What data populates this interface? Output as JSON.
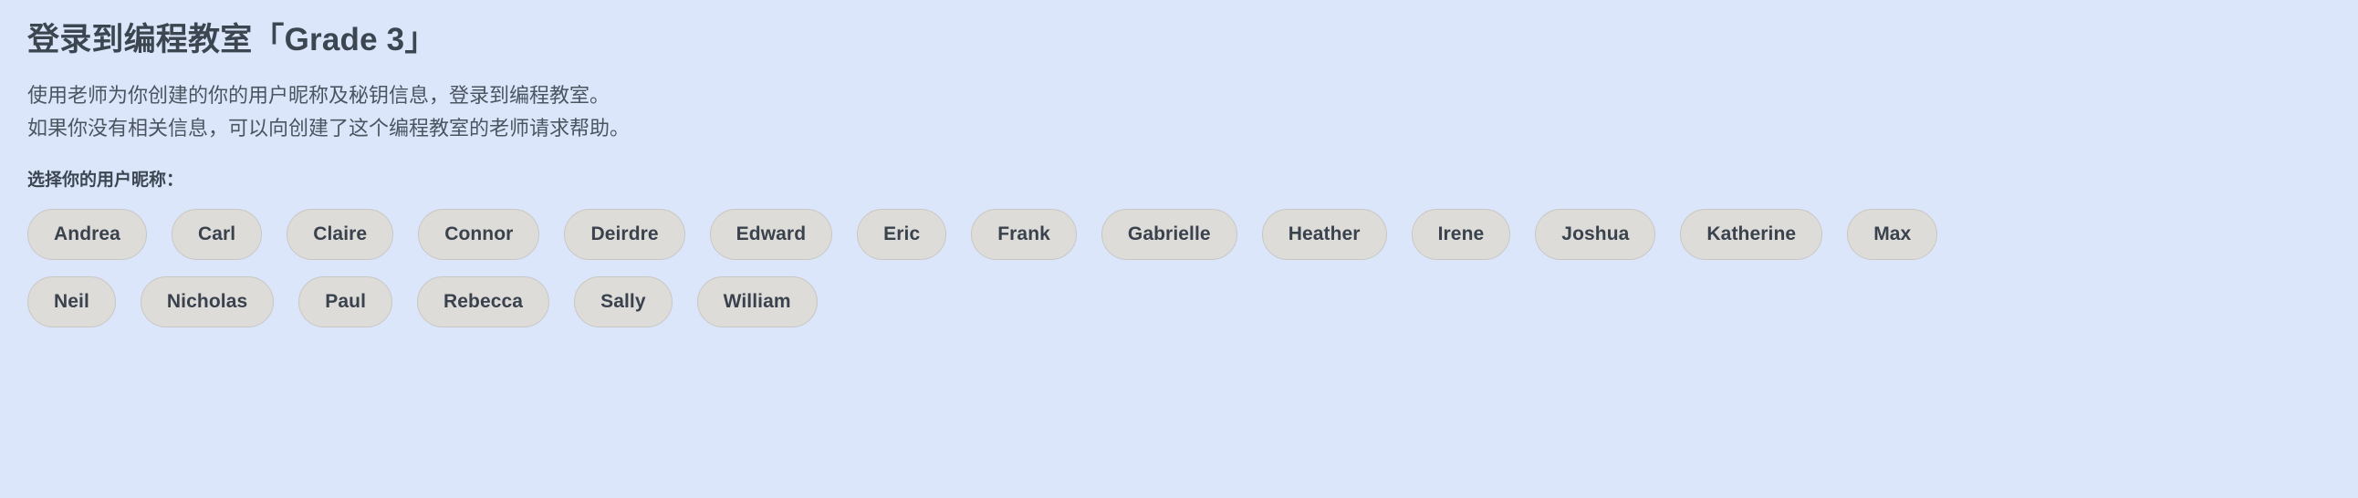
{
  "page": {
    "background_color": "#dce6fb",
    "title": "登录到编程教室「Grade 3」",
    "intro_line_1": "使用老师为你创建的你的用户昵称及秘钥信息，登录到编程教室。",
    "intro_line_2": "如果你没有相关信息，可以向创建了这个编程教室的老师请求帮助。",
    "chooser_label": "选择你的用户昵称："
  },
  "colors": {
    "text_primary": "#3b4651",
    "text_secondary": "#4a5560",
    "chip_background": "#dedcd8",
    "chip_border": "#c8c7c3",
    "chip_text": "#39424d"
  },
  "name_rows": [
    [
      {
        "label": "Andrea"
      },
      {
        "label": "Carl"
      },
      {
        "label": "Claire"
      },
      {
        "label": "Connor"
      },
      {
        "label": "Deirdre"
      },
      {
        "label": "Edward"
      },
      {
        "label": "Eric"
      },
      {
        "label": "Frank"
      },
      {
        "label": "Gabrielle"
      },
      {
        "label": "Heather"
      },
      {
        "label": "Irene"
      },
      {
        "label": "Joshua"
      },
      {
        "label": "Katherine"
      },
      {
        "label": "Max"
      }
    ],
    [
      {
        "label": "Neil"
      },
      {
        "label": "Nicholas"
      },
      {
        "label": "Paul"
      },
      {
        "label": "Rebecca"
      },
      {
        "label": "Sally"
      },
      {
        "label": "William"
      }
    ]
  ]
}
